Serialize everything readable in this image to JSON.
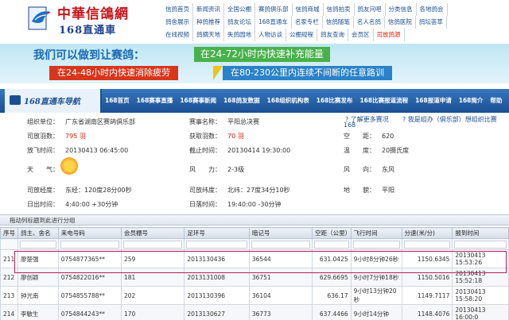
{
  "site": {
    "logo_main": "中華信鴿網",
    "logo_sub": "168直通車"
  },
  "topnav": {
    "rows": [
      [
        "信鸽首页",
        "新闻资讯",
        "全国公棚",
        "赛鸽俱乐部",
        "信鸽商城",
        "信鸽拍卖",
        "鸽友问吧",
        "分类信息",
        "各地鸽会"
      ],
      [
        "鸽舍展示",
        "种鸽推荐",
        "鸽友论坛",
        "168直通车",
        "名家专栏",
        "信鸽随笔",
        "名人名鸽",
        "信鸽医院",
        "鸽坛荟萃"
      ],
      [
        "在线视频",
        "鸽摘天地",
        "失鸽园地",
        "人物访谈",
        "公棚规程",
        "鸽友查询",
        "会员区",
        "司放鸽源"
      ]
    ],
    "red_item": "司放鸽源"
  },
  "banner": {
    "line1": "我们可以做到让赛鸽：",
    "box1": "在24-72小时内快速补充能量",
    "box2": "在24-48小时内快速消除疲劳",
    "box3": "在80-230公里内连续不间断的任意路训"
  },
  "navbar": {
    "title": "168直通车导航",
    "links": [
      "168首页",
      "168赛事直播",
      "168赛事新闻",
      "168鸽友数据",
      "168组织机构表",
      "168比赛发布",
      "168比赛报道流程",
      "168报道申请",
      "168简介",
      "帮助"
    ]
  },
  "race": {
    "org_label": "组织单位：",
    "org_value": "广东省湖南区赛鸽俱乐部",
    "event_label": "赛事名称：",
    "event_value": "平阳总决赛",
    "link1": "了解更多赛况",
    "link1b": "168",
    "link2": "我是组办（俱乐部）想组织比赛",
    "release_count_label": "司放羽数：",
    "release_count_value": "795 羽",
    "returned_label": "获取羽数：",
    "returned_value": "70 羽",
    "airline_label": "空　　距：",
    "airline_value": "620",
    "release_time_label": "放飞时间：",
    "release_time_value": "20130413 06:45:00",
    "cutoff_label": "截止时间：",
    "cutoff_value": "20130414 19:30:00",
    "temp_label": "温　　度：",
    "temp_value": "20摄氏度",
    "weather_label": "天　　气：",
    "wind_label": "风　　力：",
    "wind_value": "2-3级",
    "wind_dir_label": "风　　向：",
    "wind_dir_value": "东风",
    "lng_label": "司放经度：",
    "lng_value": "东经：120度28分00秒",
    "lat_label": "司放纬度：",
    "lat_value": "北纬：27度34分10秒",
    "terrain_label": "地　　貌：",
    "terrain_value": "平阳",
    "sunrise_label": "日出时间：",
    "sunrise_value": "4:40:00 +30分钟",
    "sunset_label": "日落时间：",
    "sunset_value": "19:40:00 -30分钟"
  },
  "table": {
    "group_hint": "拖动列标题到此进行分组",
    "columns": [
      "序号",
      "鸽主、舍名",
      "来电号码",
      "会员棚号",
      "足环号",
      "暗记号",
      "空距（公里）",
      "飞行时间",
      "分速(米/分)",
      "报到时间"
    ],
    "rows": [
      {
        "no": "211",
        "owner": "廖楚强",
        "phone": "0754877365**",
        "member": "259",
        "ring": "2013130436",
        "mark": "36544",
        "dist": "631.0425",
        "flight": "9小时8分钟26秒",
        "speed": "1150.6345",
        "report": "20130413 15:53:26"
      },
      {
        "no": "212",
        "owner": "廖创颖",
        "phone": "0754822016**",
        "member": "181",
        "ring": "2013131008",
        "mark": "36751",
        "dist": "629.6695",
        "flight": "9小时7分钟18秒",
        "speed": "1150.5016",
        "report": "20130413 15:52:18"
      },
      {
        "no": "213",
        "owner": "钟光南",
        "phone": "0754855788**",
        "member": "202",
        "ring": "2013130396",
        "mark": "36104",
        "dist": "636.17",
        "flight": "9小时13分钟20秒",
        "speed": "1149.7117",
        "report": "20130413 15:58:20"
      },
      {
        "no": "214",
        "owner": "李敏生",
        "phone": "0754844243**",
        "member": "170",
        "ring": "2013130627",
        "mark": "36773",
        "dist": "637.4466",
        "flight": "9小时14分钟",
        "speed": "1148.4076",
        "report": "20130413 16:00:0"
      }
    ]
  },
  "colors": {
    "brand_blue": "#1b4f93",
    "brand_red": "#c4161c",
    "highlight_border": "#b8205a",
    "banner_green": "#47b14a",
    "banner_red": "#d8361c",
    "banner_blue": "#2a82c8"
  },
  "icons": [
    "pigeon-logo-icon",
    "sun-weather-icon",
    "nav-car-icon",
    "help-link-icon"
  ]
}
